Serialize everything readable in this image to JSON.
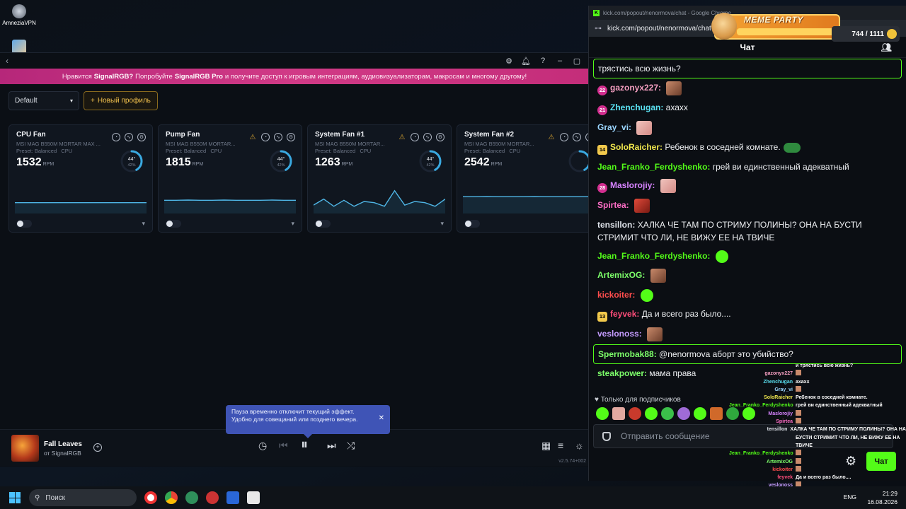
{
  "desktop": {
    "icons": [
      {
        "label": "AmneziaVPN"
      },
      {
        "label": ""
      }
    ]
  },
  "signalrgb": {
    "promo": {
      "pre": "Нравится",
      "brand": "SignalRGB?",
      "mid": "Попробуйте",
      "pro": "SignalRGB Pro",
      "post": "и получите доступ к игровым интеграциям, аудиовизуализаторам, макросам и многому другому!"
    },
    "profile_select": "Default",
    "new_profile_label": "Новый профиль",
    "cards": [
      {
        "title": "CPU Fan",
        "device": "MSI MAG B550M MORTAR MAX ...",
        "preset": "Preset: Balanced",
        "sensor": "CPU",
        "rpm": "1532",
        "unit": "RPM",
        "temp": "44°",
        "pct": "42%",
        "warn": false,
        "gauge": 0.42,
        "series": [
          0.45,
          0.45,
          0.45,
          0.45,
          0.45,
          0.45,
          0.45,
          0.45,
          0.45,
          0.45,
          0.45,
          0.45
        ]
      },
      {
        "title": "Pump Fan",
        "device": "MSI MAG B550M MORTAR...",
        "preset": "Preset: Balanced",
        "sensor": "CPU",
        "rpm": "1815",
        "unit": "RPM",
        "temp": "44°",
        "pct": "42%",
        "warn": true,
        "gauge": 0.42,
        "series": [
          0.55,
          0.55,
          0.56,
          0.55,
          0.55,
          0.56,
          0.55,
          0.55,
          0.55,
          0.56,
          0.55,
          0.55
        ]
      },
      {
        "title": "System Fan #1",
        "device": "MSI MAG B550M MORTAR...",
        "preset": "Preset: Balanced",
        "sensor": "CPU",
        "rpm": "1263",
        "unit": "RPM",
        "temp": "44°",
        "pct": "42%",
        "warn": true,
        "gauge": 0.42,
        "series": [
          0.35,
          0.6,
          0.3,
          0.55,
          0.3,
          0.5,
          0.45,
          0.3,
          0.95,
          0.35,
          0.5,
          0.45,
          0.3,
          0.6
        ]
      },
      {
        "title": "System Fan #2",
        "device": "MSI MAG B550M MORTAR...",
        "preset": "Preset: Balanced",
        "sensor": "CPU",
        "rpm": "2542",
        "unit": "RPM",
        "temp": "",
        "pct": "",
        "warn": true,
        "gauge": 0.42,
        "series": [
          0.7,
          0.7,
          0.71,
          0.7,
          0.7,
          0.7,
          0.71,
          0.7,
          0.7,
          0.7,
          0.7,
          0.7
        ]
      }
    ],
    "player": {
      "title": "Fall Leaves",
      "subtitle": "от SignalRGB",
      "version": "v2.5.74+002"
    },
    "tooltip": "Пауза временно отключит текущий эффект. Удобно для совещаний или позднего вечера."
  },
  "chat": {
    "window_title": "kick.com/popout/nenormova/chat - Google Chrome",
    "url": "kick.com/popout/nenormova/chat",
    "meme_party": "MEME PARTY",
    "meme_count": "744 / 1111",
    "header": "Чат",
    "top_partial": "трястись всю жизнь?",
    "messages": [
      {
        "badge": "22",
        "badge_type": "sub",
        "user": "gazonyx227:",
        "color": "#f59fc1",
        "text": "",
        "emote": "face"
      },
      {
        "badge": "21",
        "badge_type": "sub",
        "user": "Zhenchugan:",
        "color": "#5ae0f0",
        "text": "ахахх",
        "emote": ""
      },
      {
        "badge": "",
        "badge_type": "",
        "user": "Gray_vi:",
        "color": "#9bd6ff",
        "text": "",
        "emote": "pink"
      },
      {
        "badge": "14",
        "badge_type": "yellow",
        "user": "SoloRaicher:",
        "color": "#f2e94e",
        "text": "Ребенок в соседней комнате.",
        "emote": "frog"
      },
      {
        "badge": "",
        "badge_type": "",
        "user": "Jean_Franko_Ferdyshenko:",
        "color": "#53fc18",
        "text": "грей ви единственный адекватный",
        "emote": ""
      },
      {
        "badge": "28",
        "badge_type": "sub",
        "user": "Maslorojiy:",
        "color": "#d783ff",
        "text": "",
        "emote": "pink"
      },
      {
        "badge": "",
        "badge_type": "",
        "user": "Spirtea:",
        "color": "#ff6ec7",
        "text": "",
        "emote": "red"
      },
      {
        "badge": "",
        "badge_type": "",
        "user": "tensillon:",
        "color": "#dfe3ea",
        "text": "ХАЛКА ЧЕ ТАМ ПО СТРИМУ ПОЛИНЫ? ОНА НА БУСТИ СТРИМИТ ЧТО ЛИ, НЕ ВИЖУ ЕЕ НА ТВИЧЕ",
        "emote": ""
      },
      {
        "badge": "",
        "badge_type": "",
        "user": "Jean_Franko_Ferdyshenko:",
        "color": "#53fc18",
        "text": "",
        "emote": "green"
      },
      {
        "badge": "",
        "badge_type": "",
        "user": "ArtemixOG:",
        "color": "#7dff6a",
        "text": "",
        "emote": "face"
      },
      {
        "badge": "",
        "badge_type": "",
        "user": "kickoiter:",
        "color": "#ff4d4d",
        "text": "",
        "emote": "green"
      },
      {
        "badge": "13",
        "badge_type": "yellow",
        "user": "feyvek:",
        "color": "#ff4d7a",
        "text": "Да и всего раз было....",
        "emote": ""
      },
      {
        "badge": "",
        "badge_type": "",
        "user": "veslonoss:",
        "color": "#c59cff",
        "text": "",
        "emote": "face"
      },
      {
        "badge": "",
        "badge_type": "",
        "user": "Spermobak88:",
        "color": "#7dff6a",
        "text": "@nenormova аборт это убийство?",
        "emote": "",
        "highlight": true
      },
      {
        "badge": "",
        "badge_type": "",
        "user": "steakpower:",
        "color": "#7dff6a",
        "text": "мама права",
        "emote": ""
      }
    ],
    "subs_only": "Только для подписчиков",
    "input_placeholder": "Отправить сообщение",
    "send_label": "Чат"
  },
  "overlay": [
    {
      "name": "",
      "text": "и трястись всю жизнь?",
      "color": "#ffffff"
    },
    {
      "name": "gazonyx227",
      "text": "",
      "color": "#f59fc1"
    },
    {
      "name": "Zhenchugan",
      "text": "ахахх",
      "color": "#5ae0f0"
    },
    {
      "name": "Gray_vi",
      "text": "",
      "color": "#9bd6ff"
    },
    {
      "name": "SoloRaicher",
      "text": "Ребенок в соседней комнате.",
      "color": "#f2e94e"
    },
    {
      "name": "Jean_Franko_Ferdyshenko",
      "text": "грей ви единственный адекватный",
      "color": "#53fc18"
    },
    {
      "name": "Maslorojiy",
      "text": "",
      "color": "#d783ff"
    },
    {
      "name": "Spirtea",
      "text": "",
      "color": "#ff6ec7"
    },
    {
      "name": "tensillon",
      "text": "ХАЛКА ЧЕ ТАМ ПО СТРИМУ ПОЛИНЫ? ОНА НА",
      "color": "#dfe3ea"
    },
    {
      "name": "",
      "text": "БУСТИ СТРИМИТ ЧТО ЛИ, НЕ ВИЖУ ЕЕ НА",
      "color": "#ffffff"
    },
    {
      "name": "",
      "text": "ТВИЧЕ",
      "color": "#ffffff"
    },
    {
      "name": "Jean_Franko_Ferdyshenko",
      "text": "",
      "color": "#53fc18"
    },
    {
      "name": "ArtemixOG",
      "text": "",
      "color": "#7dff6a"
    },
    {
      "name": "kickoiter",
      "text": "",
      "color": "#ff4d4d"
    },
    {
      "name": "feyvek",
      "text": "Да и всего раз было....",
      "color": "#ff4d7a"
    },
    {
      "name": "veslonoss",
      "text": "",
      "color": "#c59cff"
    },
    {
      "name": "Spermobak88",
      "text": "@nenormova аборт это убийство?",
      "color": "#7dff6a"
    },
    {
      "name": "steakpower",
      "text": "мама права",
      "color": "#7dff6a"
    }
  ],
  "taskbar": {
    "search_placeholder": "Поиск",
    "lang": "ENG",
    "time": "21:29",
    "date": "16.08.2026"
  }
}
